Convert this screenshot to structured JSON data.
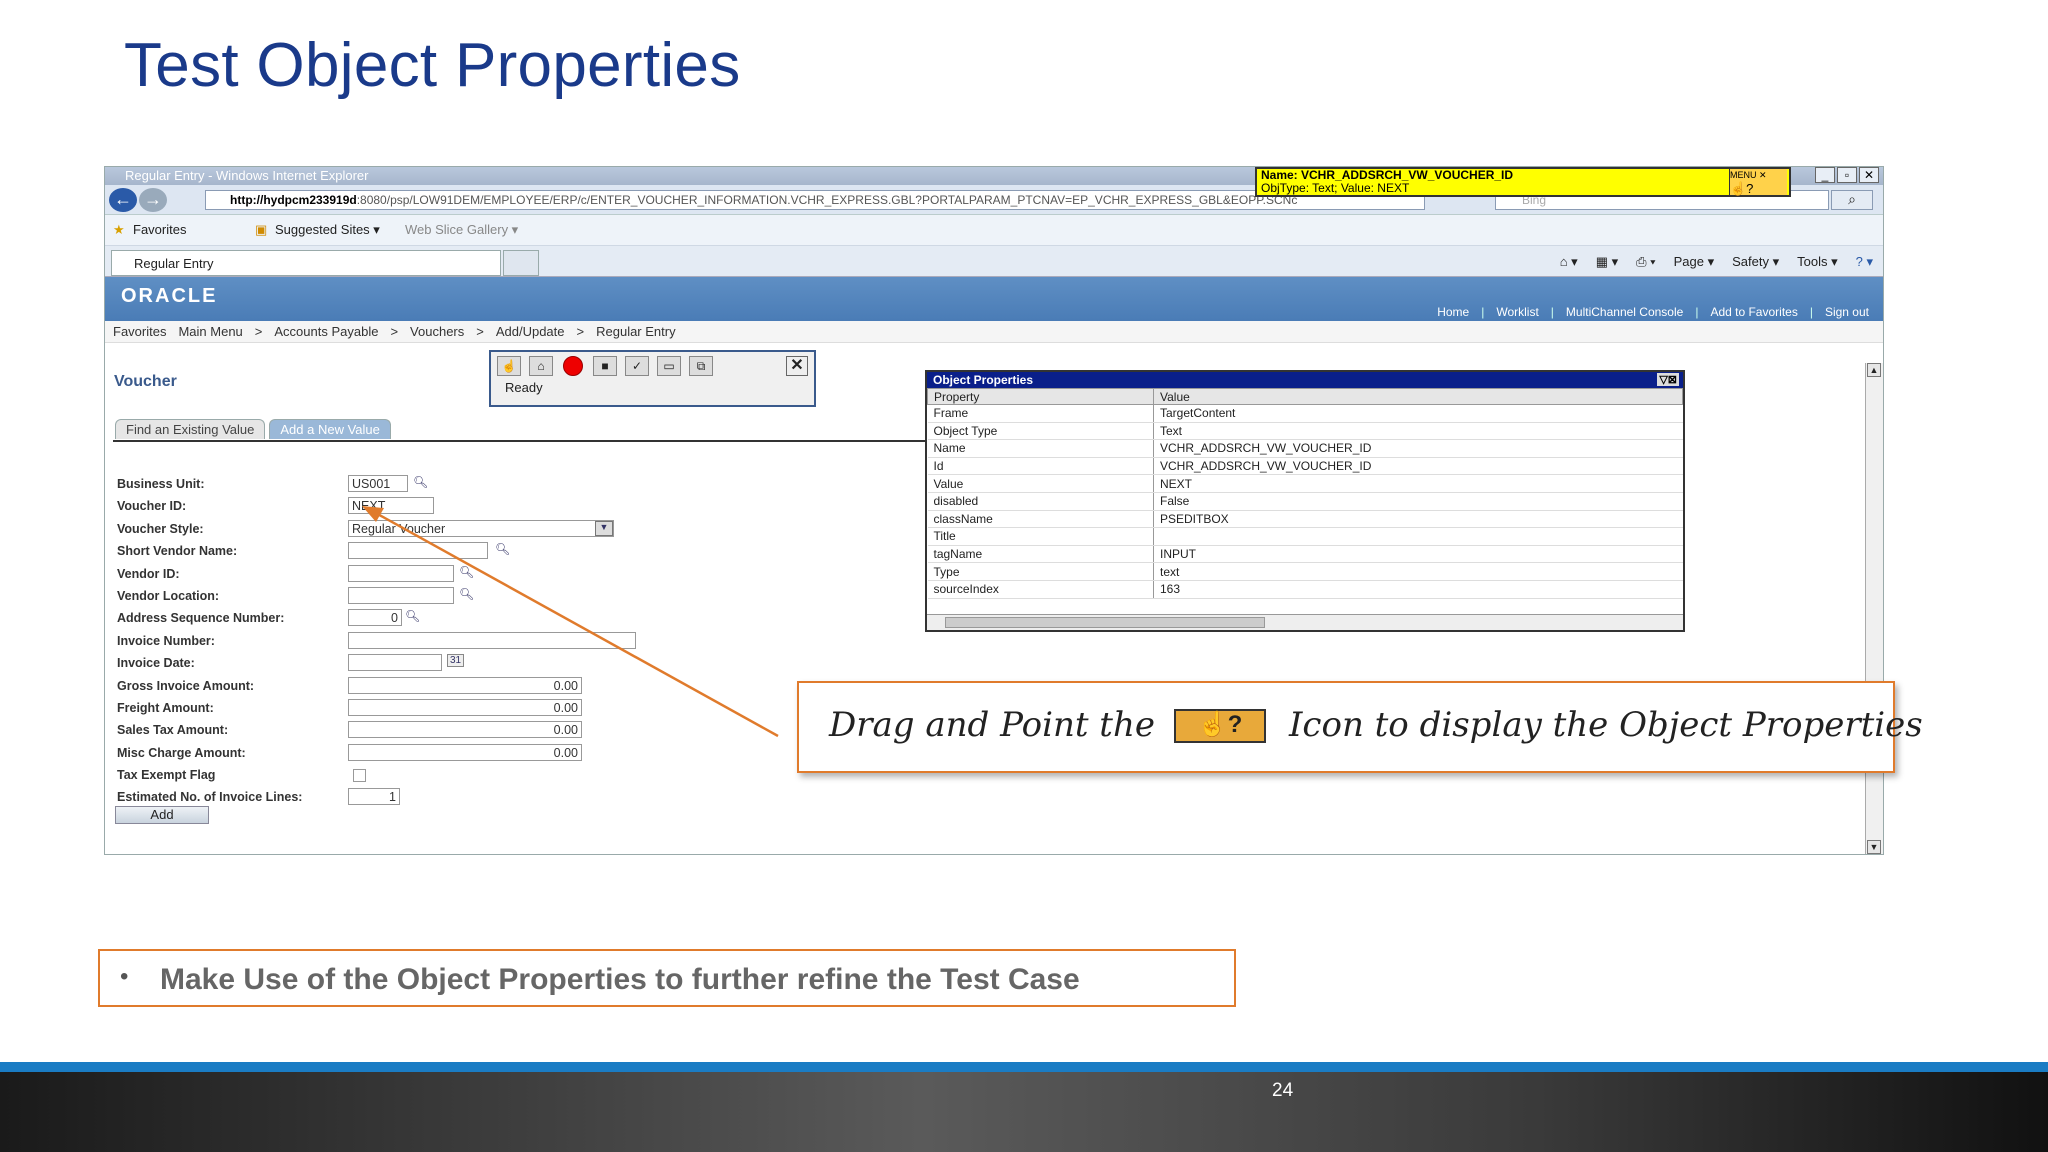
{
  "slide": {
    "title": "Test Object Properties",
    "page_number": "24",
    "bullet": "Make Use of the Object Properties to further refine the Test Case",
    "callout": {
      "before": "Drag and Point the",
      "after": "Icon to display the Object Properties",
      "icon_label": "☝?"
    }
  },
  "browser": {
    "window_title": "Regular Entry - Windows Internet Explorer",
    "url_host": "http://hydpcm233919d",
    "url_rest": ":8080/psp/LOW91DEM/EMPLOYEE/ERP/c/ENTER_VOUCHER_INFORMATION.VCHR_EXPRESS.GBL?PORTALPARAM_PTCNAV=EP_VCHR_EXPRESS_GBL&EOPP.SCNc",
    "search_placeholder": "Bing",
    "favorites_label": "Favorites",
    "suggested_sites": "Suggested Sites ▾",
    "web_slice": "Web Slice Gallery ▾",
    "tab_label": "Regular Entry",
    "commands": [
      "Page ▾",
      "Safety ▾",
      "Tools ▾"
    ]
  },
  "tooltip": {
    "line1": "Name: VCHR_ADDSRCH_VW_VOUCHER_ID",
    "line2": "ObjType: Text; Value: NEXT",
    "menu": "MENU"
  },
  "app": {
    "logo": "ORACLE",
    "nav_links": [
      "Home",
      "Worklist",
      "MultiChannel Console",
      "Add to Favorites",
      "Sign out"
    ],
    "breadcrumb": [
      "Favorites",
      "Main Menu",
      ">",
      "Accounts Payable",
      ">",
      "Vouchers",
      ">",
      "Add/Update",
      ">",
      "Regular Entry"
    ],
    "page_heading": "Voucher",
    "tabs": [
      "Find an Existing Value",
      "Add a New Value"
    ],
    "recorder_status": "Ready",
    "add_button": "Add",
    "form": [
      {
        "label": "Business Unit:",
        "value": "US001"
      },
      {
        "label": "Voucher ID:",
        "value": "NEXT"
      },
      {
        "label": "Voucher Style:",
        "value": "Regular Voucher"
      },
      {
        "label": "Short Vendor Name:",
        "value": ""
      },
      {
        "label": "Vendor ID:",
        "value": ""
      },
      {
        "label": "Vendor Location:",
        "value": ""
      },
      {
        "label": "Address Sequence Number:",
        "value": "0"
      },
      {
        "label": "Invoice Number:",
        "value": ""
      },
      {
        "label": "Invoice Date:",
        "value": ""
      },
      {
        "label": "Gross Invoice Amount:",
        "value": "0.00"
      },
      {
        "label": "Freight Amount:",
        "value": "0.00"
      },
      {
        "label": "Sales Tax Amount:",
        "value": "0.00"
      },
      {
        "label": "Misc Charge Amount:",
        "value": "0.00"
      },
      {
        "label": "Tax Exempt Flag",
        "value": ""
      },
      {
        "label": "Estimated No. of Invoice Lines:",
        "value": "1"
      }
    ]
  },
  "object_properties": {
    "title": "Object Properties",
    "headers": [
      "Property",
      "Value"
    ],
    "rows": [
      [
        "Frame",
        "TargetContent"
      ],
      [
        "Object Type",
        "Text"
      ],
      [
        "Name",
        "VCHR_ADDSRCH_VW_VOUCHER_ID"
      ],
      [
        "Id",
        "VCHR_ADDSRCH_VW_VOUCHER_ID"
      ],
      [
        "Value",
        "NEXT"
      ],
      [
        "disabled",
        "False"
      ],
      [
        "className",
        "PSEDITBOX"
      ],
      [
        "Title",
        ""
      ],
      [
        "tagName",
        "INPUT"
      ],
      [
        "Type",
        "text"
      ],
      [
        "sourceIndex",
        "163"
      ]
    ]
  },
  "colors": {
    "title": "#1a3a8a",
    "accent": "#e07b2c",
    "footer_blue": "#1a7cc4"
  }
}
